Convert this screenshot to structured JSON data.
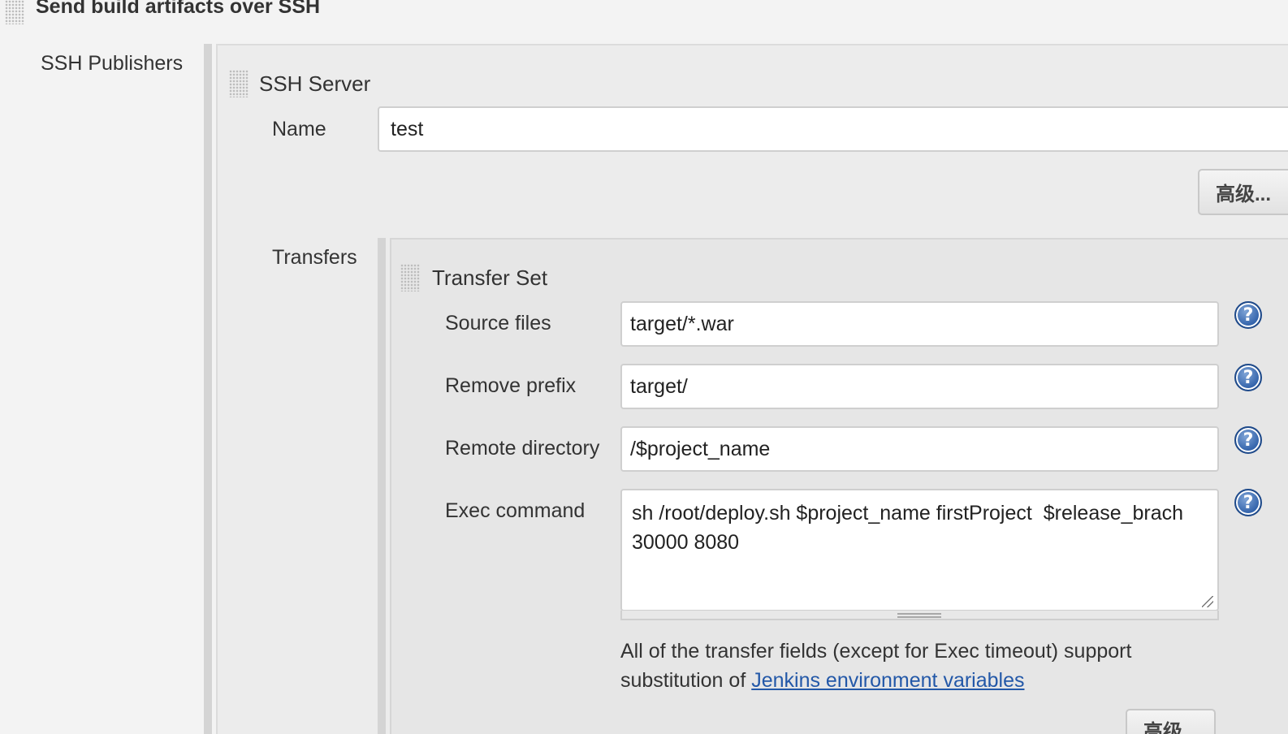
{
  "section": {
    "title": "Send build artifacts over SSH"
  },
  "publishers": {
    "label": "SSH Publishers"
  },
  "ssh_server": {
    "heading": "SSH Server",
    "name_label": "Name",
    "name_value": "test",
    "advanced_button": "高级..."
  },
  "transfers": {
    "label": "Transfers",
    "set_heading": "Transfer Set",
    "fields": [
      {
        "label": "Source files",
        "value": "target/*.war"
      },
      {
        "label": "Remove prefix",
        "value": "target/"
      },
      {
        "label": "Remote directory",
        "value": "/$project_name"
      }
    ],
    "exec_label": "Exec command",
    "exec_value": "sh /root/deploy.sh $project_name firstProject  $release_brach 30000 8080",
    "note_text": "All of the transfer fields (except for Exec timeout) support substitution of ",
    "note_link": "Jenkins environment variables",
    "advanced_button": "高级..."
  },
  "icons": {
    "help": "help-icon",
    "drag": "drag-handle-icon"
  },
  "colors": {
    "link": "#2358a8",
    "help_icon": "#2e5fa8",
    "background": "#f3f3f3"
  }
}
